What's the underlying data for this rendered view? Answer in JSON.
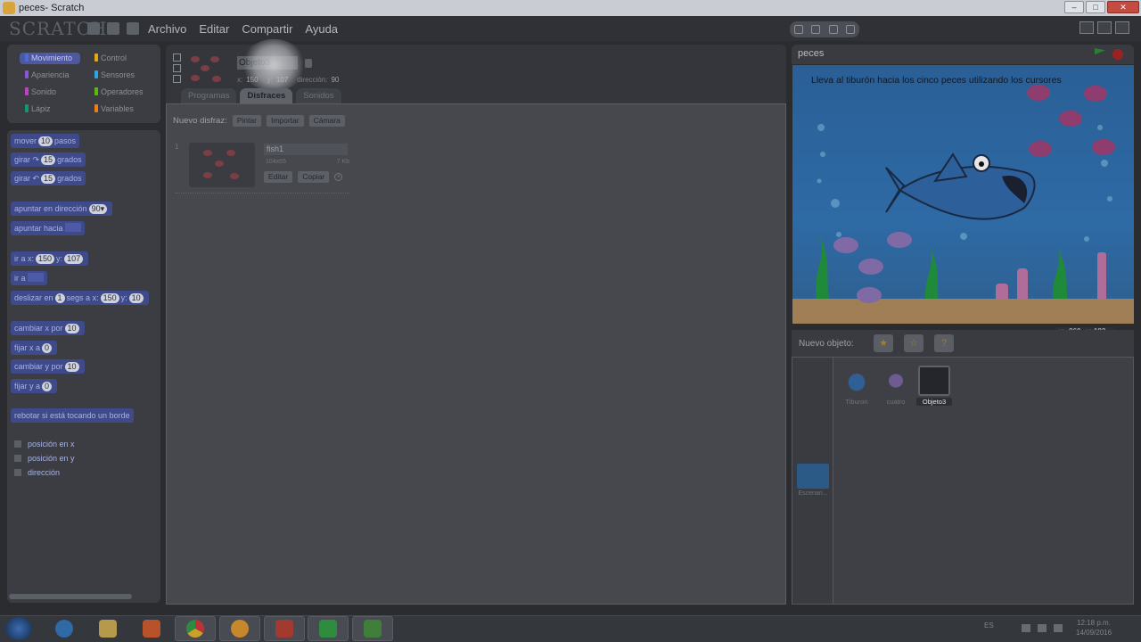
{
  "window": {
    "title": "peces- Scratch"
  },
  "menubar": {
    "logo": "SCRATCH",
    "items": [
      "Archivo",
      "Editar",
      "Compartir",
      "Ayuda"
    ]
  },
  "categories": [
    {
      "label": "Movimiento",
      "color": "#4a6cd4",
      "active": true
    },
    {
      "label": "Control",
      "color": "#e1a91a"
    },
    {
      "label": "Apariencia",
      "color": "#8a55d7"
    },
    {
      "label": "Sensores",
      "color": "#2ca5e2"
    },
    {
      "label": "Sonido",
      "color": "#bb42c3"
    },
    {
      "label": "Operadores",
      "color": "#5cb712"
    },
    {
      "label": "Lápiz",
      "color": "#0e9a6c"
    },
    {
      "label": "Variables",
      "color": "#ee7d16"
    }
  ],
  "blocks": {
    "move": {
      "pre": "mover",
      "num": "10",
      "post": "pasos"
    },
    "turn_right": {
      "pre": "girar ↷",
      "num": "15",
      "post": "grados"
    },
    "turn_left": {
      "pre": "girar ↶",
      "num": "15",
      "post": "grados"
    },
    "point_dir": {
      "pre": "apuntar en dirección",
      "num": "90▾"
    },
    "point_towards": {
      "pre": "apuntar hacia"
    },
    "goto_xy": {
      "pre": "ir a x:",
      "x": "150",
      "mid": "y:",
      "y": "107"
    },
    "goto": {
      "pre": "ir a"
    },
    "glide": {
      "pre": "deslizar en",
      "secs": "1",
      "mid": "segs a x:",
      "x": "150",
      "mid2": "y:",
      "y": "10"
    },
    "change_x": {
      "pre": "cambiar x por",
      "num": "10"
    },
    "set_x": {
      "pre": "fijar x a",
      "num": "0"
    },
    "change_y": {
      "pre": "cambiar y por",
      "num": "10"
    },
    "set_y": {
      "pre": "fijar y a",
      "num": "0"
    },
    "bounce": {
      "pre": "rebotar si está tocando un borde"
    },
    "reporters": [
      "posición en x",
      "posición en y",
      "dirección"
    ]
  },
  "sprite": {
    "name": "Objeto3",
    "x_label": "x:",
    "x": "150",
    "y_label": "y:",
    "y": "107",
    "dir_label": "dirección:",
    "dir": "90"
  },
  "tabs": [
    "Programas",
    "Disfraces",
    "Sonidos"
  ],
  "active_tab": "Disfraces",
  "costumes": {
    "new_label": "Nuevo disfraz:",
    "buttons": [
      "Pintar",
      "Importar",
      "Cámara"
    ],
    "items": [
      {
        "index": "1",
        "name": "fish1",
        "dims": "104x65",
        "size": "7 Kb",
        "edit": "Editar",
        "copy": "Copiar"
      }
    ]
  },
  "stage": {
    "title": "peces",
    "instruction": "Lleva al tiburón hacia los cinco peces utilizando los cursores",
    "mouse_x_label": "x:",
    "mouse_x": "-960",
    "mouse_y_label": "y:",
    "mouse_y": "183"
  },
  "new_sprite": {
    "label": "Nuevo objeto:"
  },
  "sprites": [
    {
      "name": "Tiburon",
      "selected": false
    },
    {
      "name": "cuatro",
      "selected": false
    },
    {
      "name": "Objeto3",
      "selected": true
    }
  ],
  "stage_thumb": {
    "label": "Escenari..."
  },
  "taskbar": {
    "lang": "ES",
    "time": "12:18 p.m.",
    "date": "14/09/2016"
  }
}
